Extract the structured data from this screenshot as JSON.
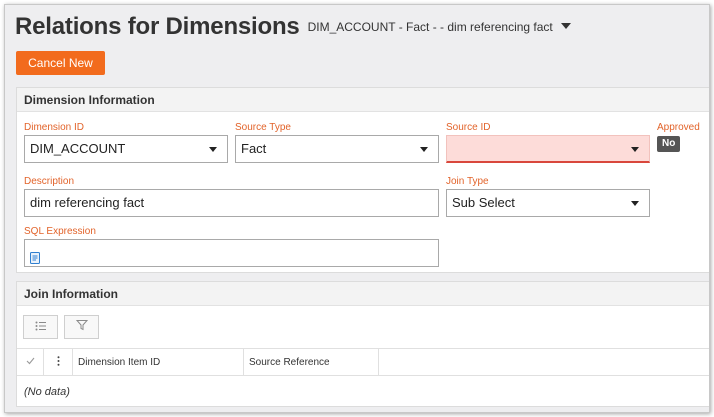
{
  "header": {
    "title": "Relations for Dimensions",
    "subtitle": "DIM_ACCOUNT - Fact - - dim referencing fact"
  },
  "actions": {
    "cancel_new_label": "Cancel New"
  },
  "dimension_info": {
    "panel_title": "Dimension Information",
    "dimension_id": {
      "label": "Dimension ID",
      "value": "DIM_ACCOUNT"
    },
    "source_type": {
      "label": "Source Type",
      "value": "Fact"
    },
    "source_id": {
      "label": "Source ID",
      "value": ""
    },
    "approved": {
      "label": "Approved",
      "value": "No"
    },
    "description": {
      "label": "Description",
      "value": "dim referencing fact"
    },
    "join_type": {
      "label": "Join Type",
      "value": "Sub Select"
    },
    "sql_expression": {
      "label": "SQL Expression",
      "value": ""
    }
  },
  "join_info": {
    "panel_title": "Join Information",
    "columns": [
      "Dimension Item ID",
      "Source Reference"
    ],
    "rows": [],
    "empty_text": "(No data)"
  },
  "icons": {
    "title_dropdown": "caret-down-icon",
    "sql_editor": "document-icon",
    "list_settings": "list-icon",
    "filter": "filter-icon",
    "select_all": "checkmark-icon",
    "row_menu": "kebab-menu-icon"
  },
  "colors": {
    "accent": "#f26b1d",
    "label": "#e2632a",
    "error_bg": "#fddcd9",
    "error_border": "#d9473c",
    "badge": "#555555"
  }
}
